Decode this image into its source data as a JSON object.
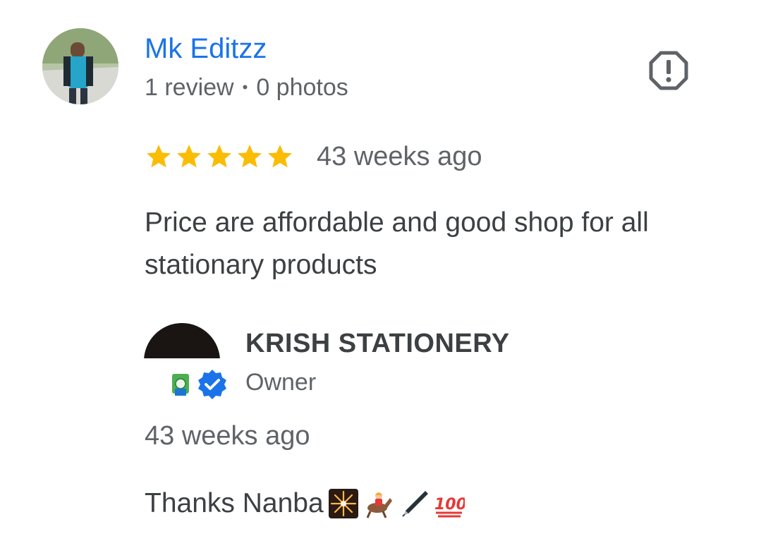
{
  "review": {
    "reviewer_name": "Mk Editzz",
    "reviewer_reviews": "1 review",
    "meta_separator": "•",
    "reviewer_photos": "0 photos",
    "rating": 5,
    "rating_max": 5,
    "time": "43 weeks ago",
    "text": "Price are affordable and good shop for all stationary products",
    "report_icon": "report-flag-icon"
  },
  "owner_reply": {
    "name": "KRISH STATIONERY",
    "role": "Owner",
    "time": "43 weeks ago",
    "text": "Thanks Nanba",
    "emojis": [
      "fireworks-emoji",
      "horse-racing-emoji",
      "pen-emoji",
      "hundred-points-emoji"
    ]
  },
  "colors": {
    "link": "#1a73e8",
    "star": "#fbbc04",
    "secondary_text": "#5f6368",
    "primary_text": "#3c4043",
    "verified": "#1a73e8"
  }
}
